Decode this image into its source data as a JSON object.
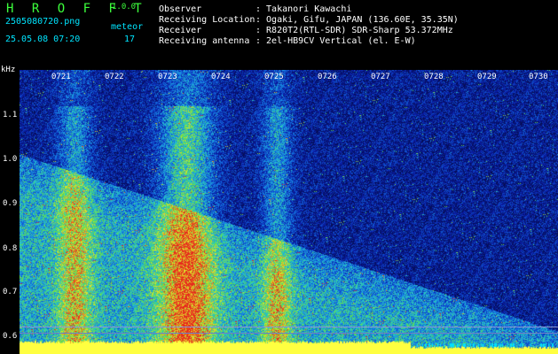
{
  "header": {
    "brand": "H R O F F T",
    "version": "1.0.0",
    "filename": "2505080720.png",
    "timestamp": "25.05.08 07:20",
    "count_label": "meteor",
    "count_value": "17"
  },
  "info": [
    {
      "label": "Observer",
      "value": ": Takanori Kawachi"
    },
    {
      "label": "Receiving Location",
      "value": ": Ogaki, Gifu, JAPAN (136.60E, 35.35N)"
    },
    {
      "label": "Receiver",
      "value": ": R820T2(RTL-SDR) SDR-Sharp 53.372MHz"
    },
    {
      "label": "Receiving antenna",
      "value": ": 2el-HB9CV Vertical (el. E-W)"
    }
  ],
  "axis": {
    "y_unit": "kHz",
    "y_ticks": [
      "1.1",
      "1.0",
      "0.9",
      "0.8",
      "0.7",
      "0.6"
    ],
    "x_ticks": [
      "0721",
      "0722",
      "0723",
      "0724",
      "0725",
      "0726",
      "0727",
      "0728",
      "0729",
      "0730"
    ]
  },
  "colors": {
    "background": "#000000",
    "spectro_base": "#0a1a8c",
    "header_cyan": "#00e5ff",
    "signal_yellow": "#ffff40"
  }
}
